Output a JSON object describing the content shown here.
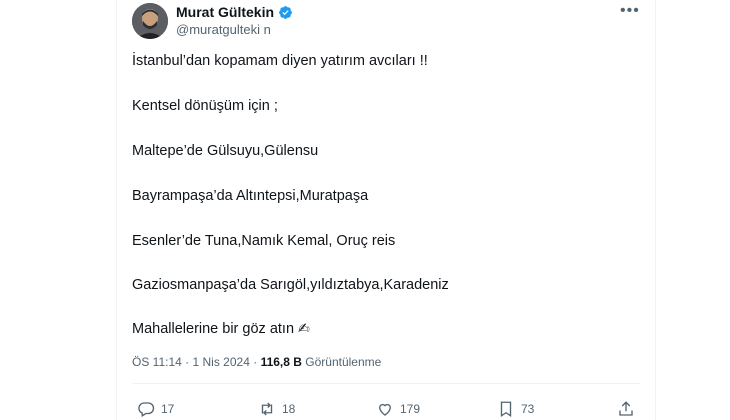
{
  "author": {
    "display_name": "Murat Gültekin",
    "handle": "@muratgulteki n"
  },
  "tweet": {
    "lines": [
      "İstanbul’dan kopamam diyen yatırım avcıları !!",
      "Kentsel dönüşüm için ;",
      "Maltepe’de Gülsuyu,Gülensu",
      "Bayrampaşa’da Altıntepsi,Muratpaşa",
      "Esenler’de Tuna,Namık Kemal, Oruç reis",
      "Gaziosmanpaşa’da Sarıgöl,yıldıztabya,Karadeniz",
      "Mahallelerine bir göz atın"
    ],
    "emoji": "✍"
  },
  "meta": {
    "time": "ÖS 11:14",
    "sep": "·",
    "date": "1 Nis 2024",
    "views": "116,8 B",
    "views_label": "Görüntülenme"
  },
  "actions": {
    "replies": "17",
    "reposts": "18",
    "likes": "179",
    "bookmarks": "73"
  },
  "icons": [
    "verified-badge-icon",
    "more-icon",
    "reply-icon",
    "repost-icon",
    "like-icon",
    "bookmark-icon",
    "share-icon"
  ],
  "colors": {
    "verified": "#1d9bf0",
    "muted": "#536471",
    "text": "#0f1419"
  }
}
